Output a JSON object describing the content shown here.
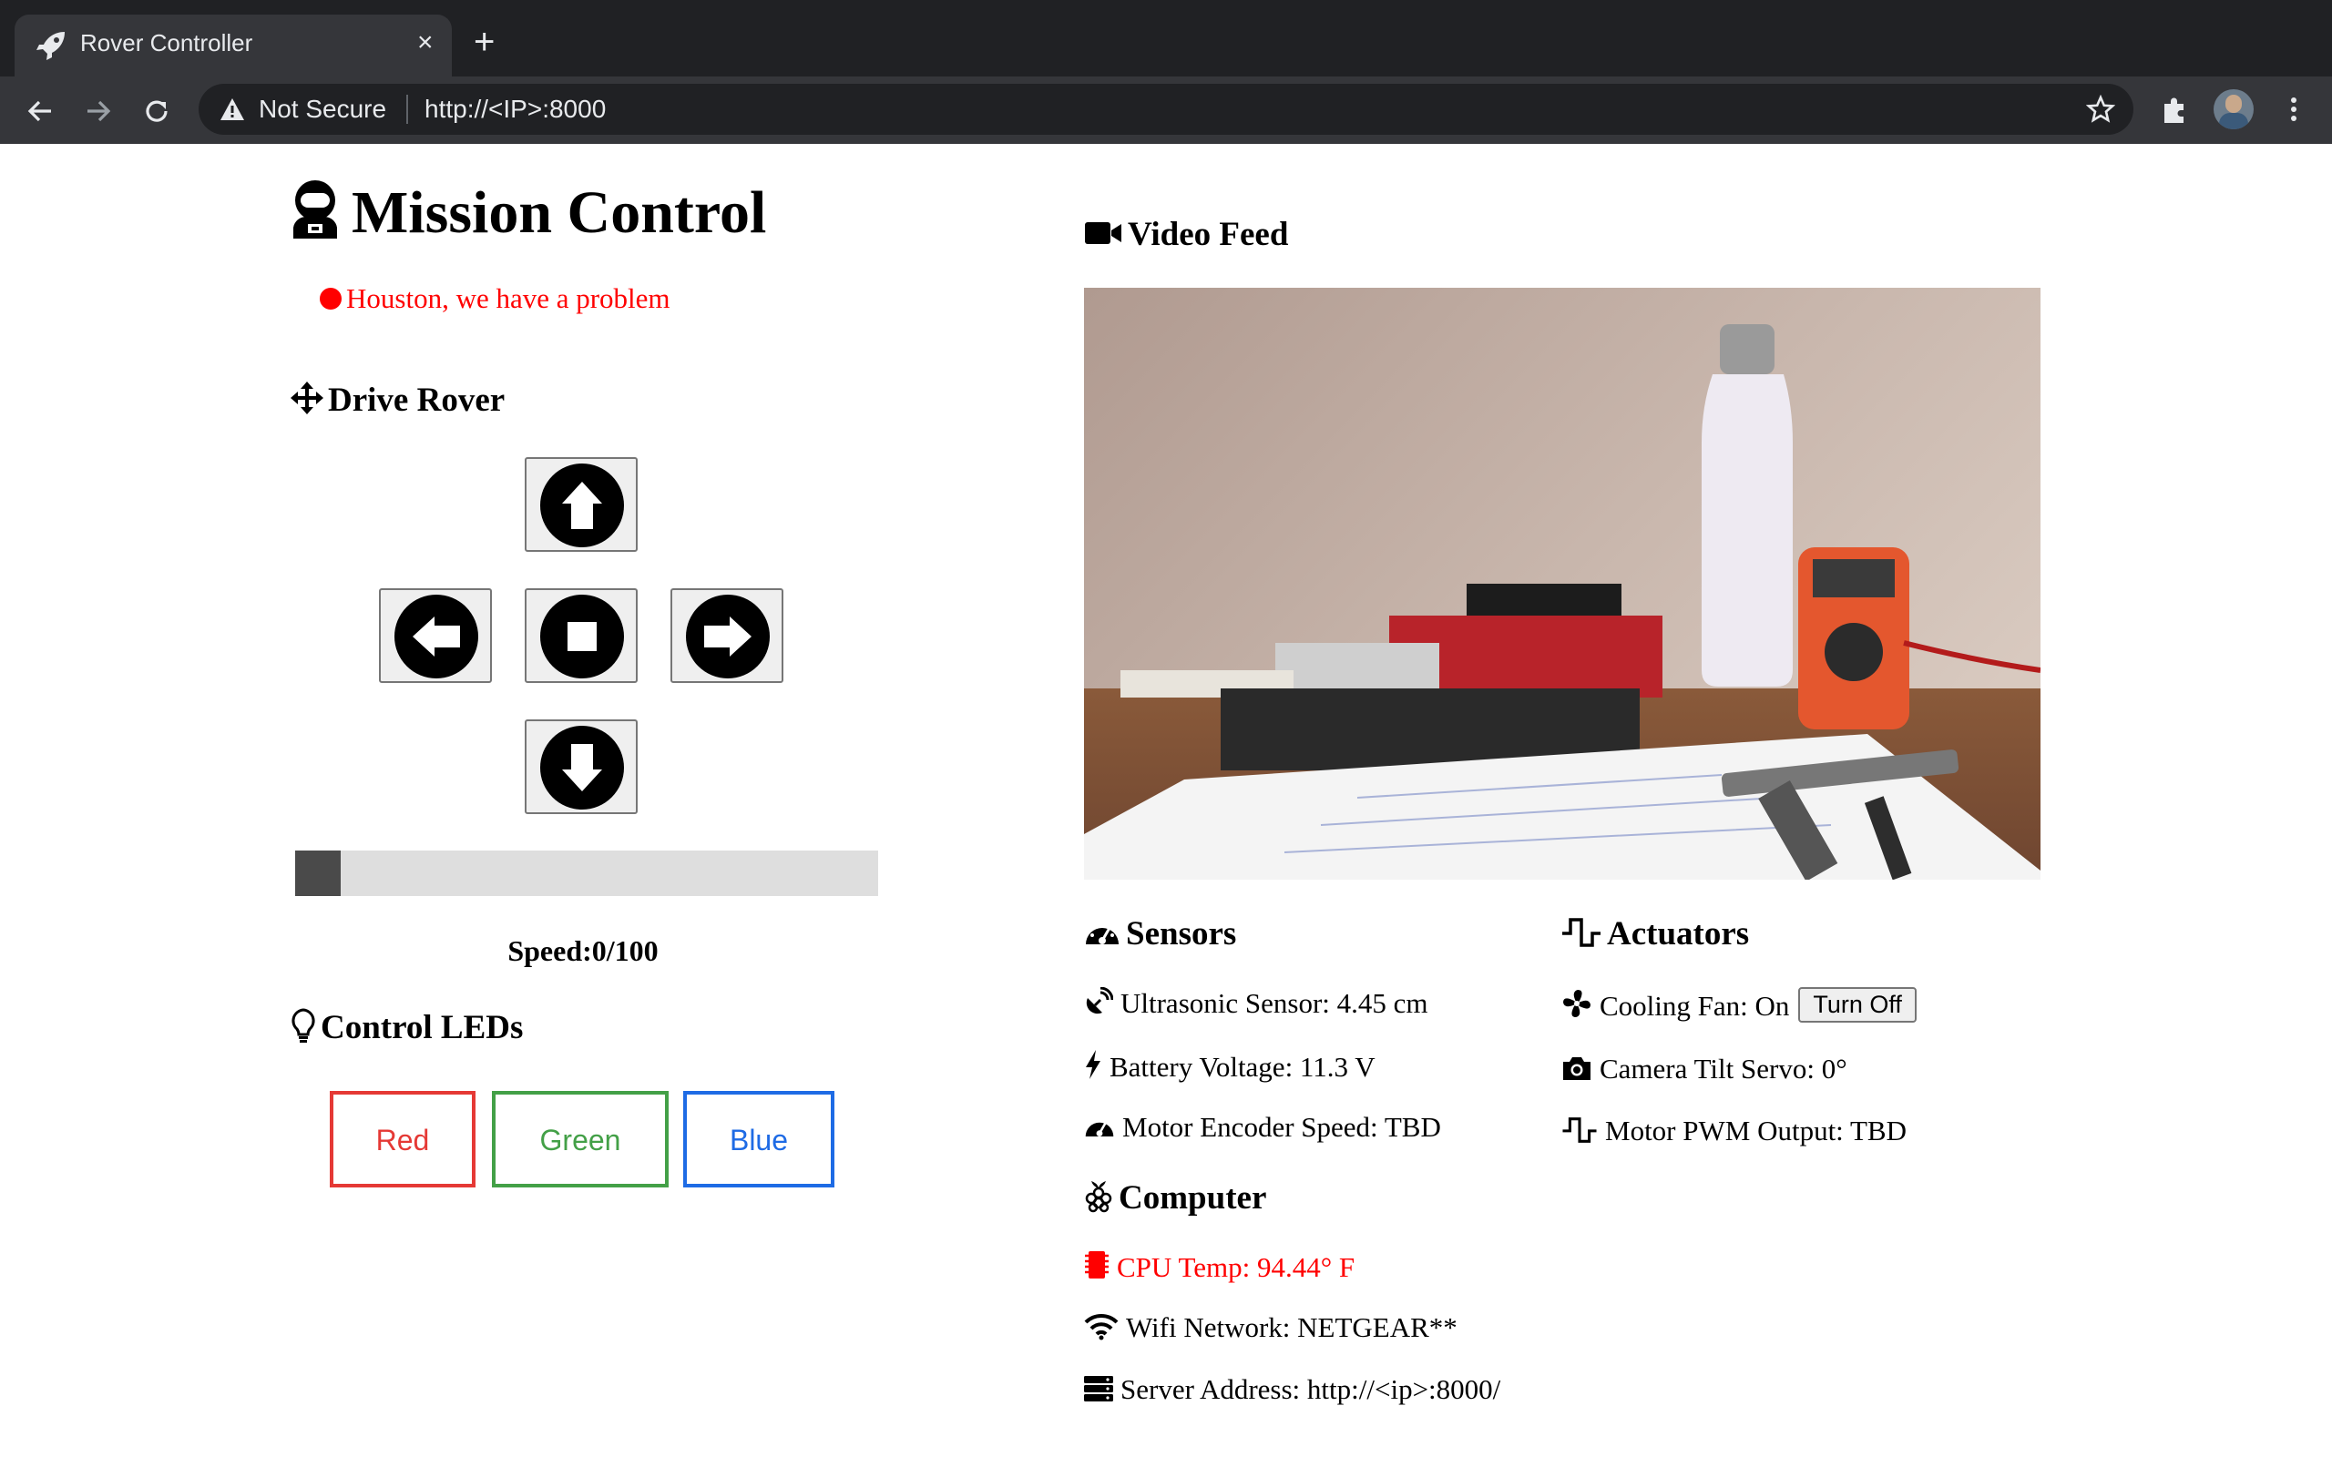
{
  "browser": {
    "tab_title": "Rover Controller",
    "tab_close": "×",
    "new_tab": "+",
    "security_label": "Not Secure",
    "url": "http://<IP>:8000"
  },
  "page": {
    "title": "Mission Control",
    "status": "Houston, we have a problem",
    "status_color": "#ff0000"
  },
  "drive": {
    "heading": "Drive Rover",
    "speed_text": "Speed:0/100",
    "speed_value": 0,
    "speed_max": 100
  },
  "leds": {
    "heading": "Control LEDs",
    "buttons": [
      {
        "label": "Red",
        "color": "#e53935"
      },
      {
        "label": "Green",
        "color": "#43a047"
      },
      {
        "label": "Blue",
        "color": "#1e6be5"
      }
    ]
  },
  "video": {
    "heading": "Video Feed"
  },
  "sensors": {
    "heading": "Sensors",
    "ultrasonic": "Ultrasonic Sensor: 4.45 cm",
    "battery": "Battery Voltage: 11.3 V",
    "encoder": "Motor Encoder Speed: TBD"
  },
  "actuators": {
    "heading": "Actuators",
    "fan": "Cooling Fan: On",
    "fan_button": "Turn Off",
    "servo": "Camera Tilt Servo: 0°",
    "pwm": "Motor PWM Output: TBD"
  },
  "computer": {
    "heading": "Computer",
    "cpu_temp": "CPU Temp: 94.44° F",
    "cpu_temp_color": "#ff0000",
    "wifi": "Wifi Network: NETGEAR**",
    "server": "Server Address: http://<ip>:8000/"
  },
  "icons": [
    "rocket-icon",
    "close-icon",
    "plus-icon",
    "back-icon",
    "forward-icon",
    "reload-icon",
    "warning-icon",
    "star-icon",
    "extensions-icon",
    "avatar",
    "more-icon",
    "astronaut-icon",
    "status-dot-icon",
    "move-icon",
    "arrow-up-icon",
    "arrow-left-icon",
    "stop-icon",
    "arrow-right-icon",
    "arrow-down-icon",
    "lightbulb-icon",
    "video-camera-icon",
    "gauge-icon",
    "satellite-dish-icon",
    "bolt-icon",
    "wave-square-icon",
    "fan-icon",
    "camera-icon",
    "raspberry-pi-icon",
    "microchip-icon",
    "wifi-icon",
    "server-icon"
  ]
}
